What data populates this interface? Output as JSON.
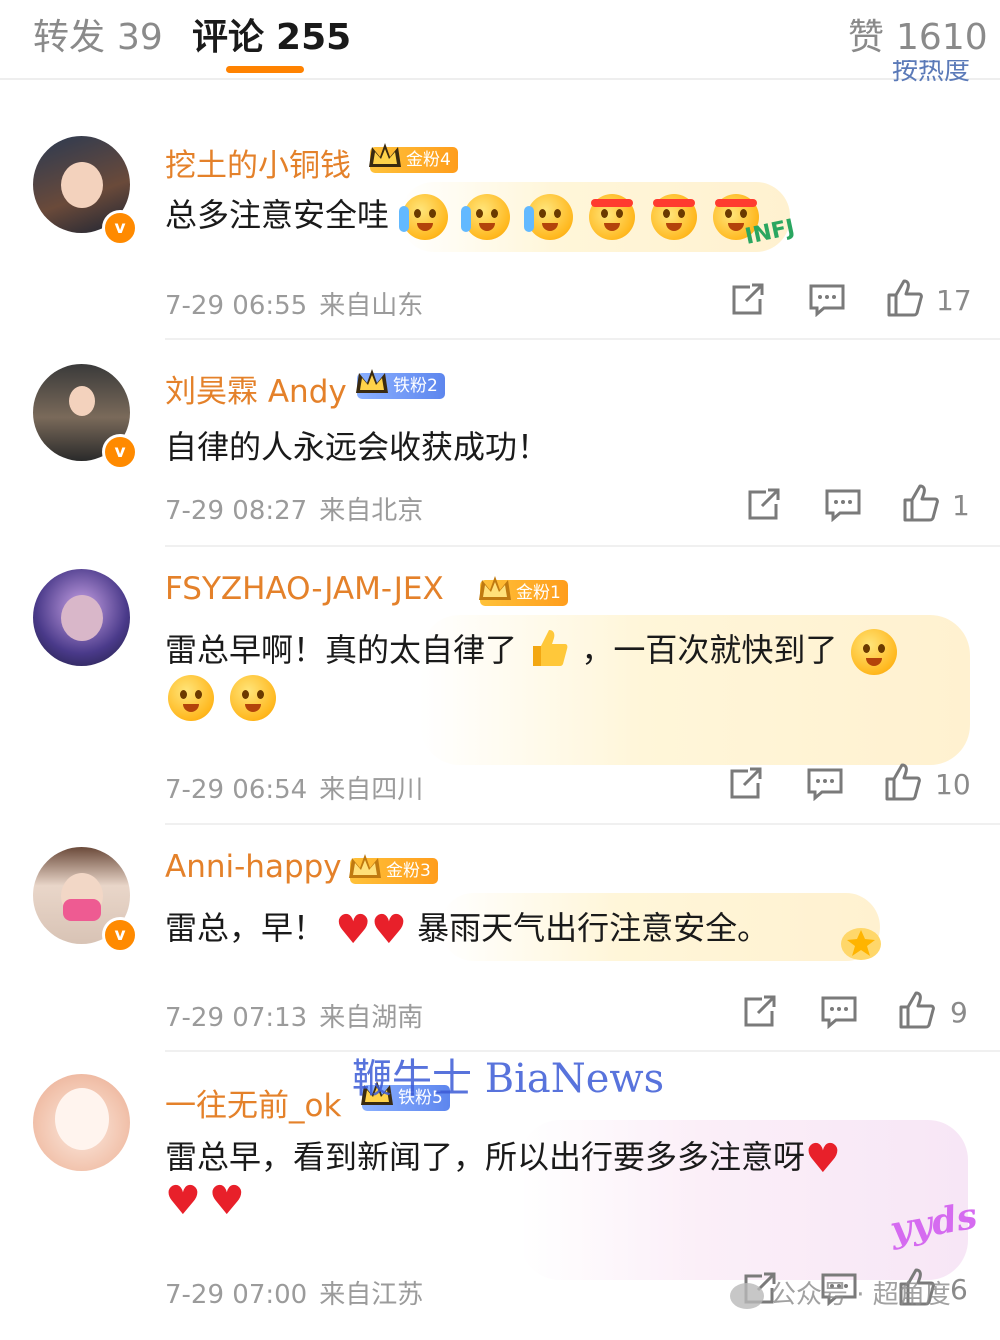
{
  "tabs": {
    "repost": {
      "label": "转发",
      "count": "39"
    },
    "comments": {
      "label": "评论",
      "count": "255"
    },
    "likes": {
      "label": "赞",
      "count": "1610"
    }
  },
  "sort_label": "按热度",
  "comments": [
    {
      "user": "挖土的小铜钱",
      "badge": "金粉4",
      "badge_type": "gold",
      "text": "总多注意安全哇",
      "time": "7-29 06:55",
      "location": "来自山东",
      "likes": "17"
    },
    {
      "user": "刘昊霖 Andy",
      "badge": "铁粉2",
      "badge_type": "iron",
      "text": "自律的人永远会收获成功！",
      "time": "7-29 08:27",
      "location": "来自北京",
      "likes": "1"
    },
    {
      "user": "FSYZHAO-JAM-JEX",
      "badge": "金粉1",
      "badge_type": "gold",
      "text_part1": "雷总早啊！真的太自律了",
      "text_part2": "，一百次就快到了",
      "time": "7-29 06:54",
      "location": "来自四川",
      "likes": "10"
    },
    {
      "user": "Anni-happy",
      "badge": "金粉3",
      "badge_type": "gold",
      "text_part1": "雷总，早！",
      "text_part2": "暴雨天气出行注意安全。",
      "time": "7-29 07:13",
      "location": "来自湖南",
      "likes": "9"
    },
    {
      "user": "一往无前_ok",
      "badge": "铁粉5",
      "badge_type": "iron",
      "text": "雷总早，看到新闻了，所以出行要多多注意呀",
      "time": "7-29 07:00",
      "location": "来自江苏",
      "likes": "6"
    }
  ],
  "deco_text": "INFJ",
  "yyds_text": "yyds",
  "watermark": "鞭牛士 BiaNews",
  "wechat_watermark": "公众号 · 超角度",
  "colors": {
    "accent": "#ff8200",
    "username": "#e4812a",
    "gold_badge": "#ffb02a",
    "iron_badge": "#6f95f4"
  }
}
